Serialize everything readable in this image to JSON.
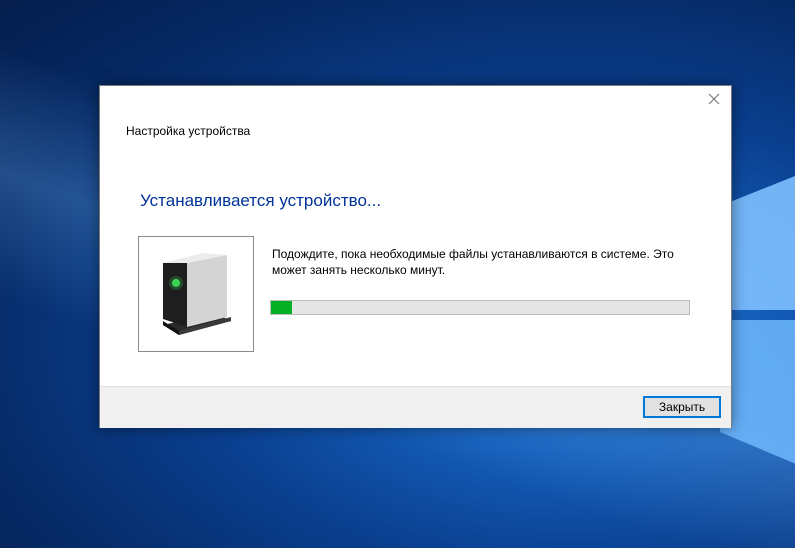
{
  "dialog": {
    "title": "Настройка устройства",
    "heading": "Устанавливается устройство...",
    "message": "Подождите, пока необходимые файлы устанавливаются в системе. Это может занять несколько минут.",
    "progress_fraction": 0.05,
    "close_button_label": "Закрыть",
    "device_icon": "device-installer-icon"
  },
  "colors": {
    "heading": "#003399",
    "progress_fill": "#06b025",
    "button_border": "#0078d7",
    "desktop": "#0a3f8f"
  }
}
